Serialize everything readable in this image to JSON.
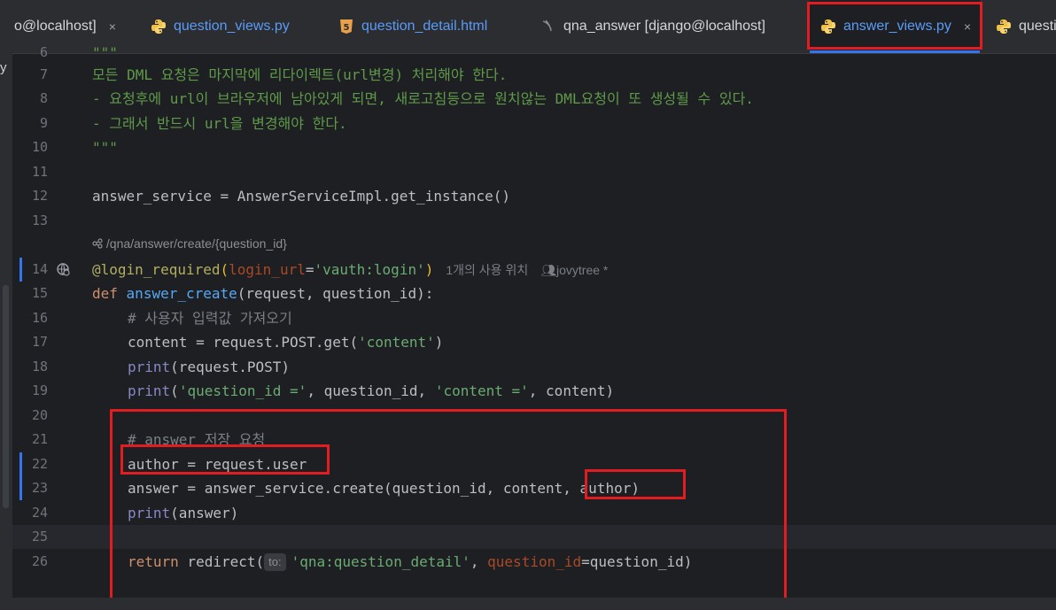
{
  "tabs": [
    {
      "label": "o@localhost]",
      "icon": "database-icon",
      "close": "×"
    },
    {
      "label": "question_views.py",
      "icon": "python-icon"
    },
    {
      "label": "question_detail.html",
      "icon": "html5-icon"
    },
    {
      "label": "qna_answer [django@localhost]",
      "icon": "mysql-table-icon"
    },
    {
      "label": "answer_views.py",
      "icon": "python-icon",
      "close": "×",
      "active": true
    },
    {
      "label": "questi",
      "icon": "python-icon"
    }
  ],
  "left_panel_text": "y",
  "editor": {
    "line_numbers": [
      "6",
      "7",
      "8",
      "9",
      "10",
      "11",
      "12",
      "13",
      "14",
      "15",
      "16",
      "17",
      "18",
      "19",
      "20",
      "21",
      "22",
      "23",
      "24",
      "25",
      "26"
    ],
    "doc_quote_top": "\"\"\"",
    "line7": "모든 DML 요청은 마지막에 리다이렉트(url변경) 처리해야 한다.",
    "line8": "- 요청후에 url이 브라우저에 남아있게 되면, 새로고침등으로 원치않는 DML요청이 또 생성될 수 있다.",
    "line9": "- 그래서 반드시 url을 변경해야 한다.",
    "line10": "\"\"\"",
    "line12_var": "answer_service",
    "line12_eq": " = ",
    "line12_rest": "AnswerServiceImpl.get_instance()",
    "url_hint": "/qna/answer/create/{question_id}",
    "line14_deco": "@login_required",
    "line14_param": "login_url",
    "line14_str": "'vauth:login'",
    "usage_hint": "1개의 사용 위치",
    "author_hint": "jovytree *",
    "line15_def": "def",
    "line15_fn": "answer_create",
    "line15_args": "(request, question_id):",
    "line16": "# 사용자 입력값 가져오기",
    "line17_a": "content = request.POST.get(",
    "line17_s": "'content'",
    "line17_b": ")",
    "line18_p": "print",
    "line18_rest": "(request.POST)",
    "line19_p": "print",
    "line19_s1": "'question_id ='",
    "line19_m": ", question_id, ",
    "line19_s2": "'content ='",
    "line19_e": ", content)",
    "line21": "# answer 저장 요청",
    "line22": "author = request.user",
    "line23": "answer = answer_service.create(question_id, content, author)",
    "line24_p": "print",
    "line24_rest": "(answer)",
    "line26_ret": "return",
    "line26_fn": " redirect(",
    "line26_hint": "to:",
    "line26_s": "'qna:question_detail'",
    "line26_param": "question_id",
    "line26_end": "=question_id)"
  },
  "colors": {
    "highlight_box": "#e21d22",
    "active_tab_text": "#5b9bf8"
  }
}
